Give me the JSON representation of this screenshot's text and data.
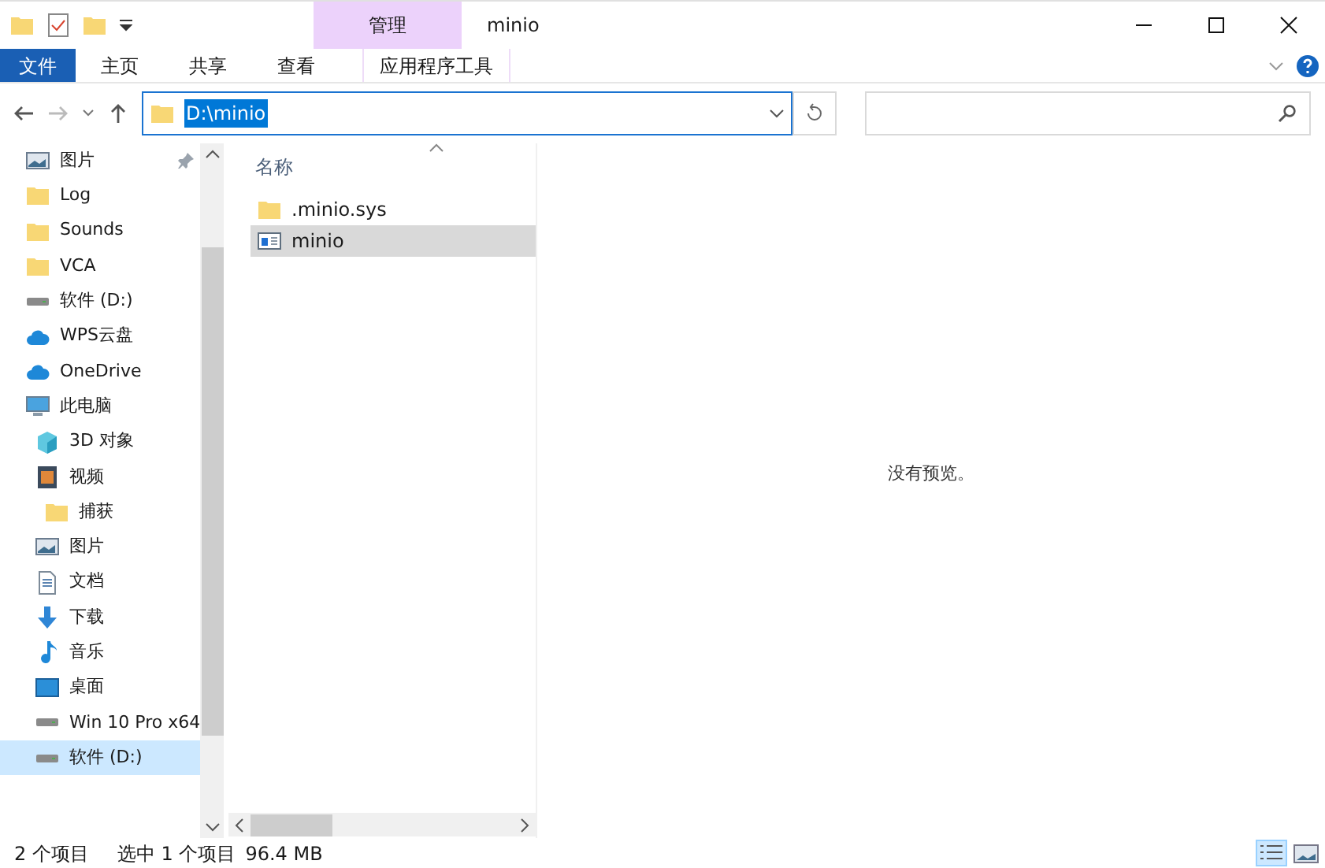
{
  "window": {
    "title": "minio",
    "context_tab": "管理"
  },
  "ribbon": {
    "tabs": [
      {
        "label": "文件",
        "kind": "file",
        "selected": false
      },
      {
        "label": "主页",
        "kind": "tab",
        "selected": false
      },
      {
        "label": "共享",
        "kind": "tab",
        "selected": false
      },
      {
        "label": "查看",
        "kind": "tab",
        "selected": false
      },
      {
        "label": "应用程序工具",
        "kind": "context",
        "selected": false
      }
    ]
  },
  "address": {
    "path": "D:\\minio",
    "selected": true
  },
  "sidebar": {
    "items": [
      {
        "label": "图片",
        "kind": "picture",
        "pinned": true,
        "selected": false
      },
      {
        "label": "Log",
        "kind": "folder",
        "selected": false
      },
      {
        "label": "Sounds",
        "kind": "folder",
        "selected": false
      },
      {
        "label": "VCA",
        "kind": "folder",
        "selected": false
      },
      {
        "label": "软件 (D:)",
        "kind": "drive",
        "selected": false
      },
      {
        "label": "WPS云盘",
        "kind": "cloud",
        "selected": false
      },
      {
        "label": "OneDrive",
        "kind": "cloud",
        "selected": false
      },
      {
        "label": "此电脑",
        "kind": "pc",
        "selected": false,
        "children": [
          {
            "label": "3D 对象",
            "kind": "cube",
            "selected": false
          },
          {
            "label": "视频",
            "kind": "video",
            "selected": false,
            "children": [
              {
                "label": "捕获",
                "kind": "folder",
                "selected": false
              }
            ]
          },
          {
            "label": "图片",
            "kind": "picture",
            "selected": false
          },
          {
            "label": "文档",
            "kind": "document",
            "selected": false
          },
          {
            "label": "下载",
            "kind": "download",
            "selected": false
          },
          {
            "label": "音乐",
            "kind": "music",
            "selected": false
          },
          {
            "label": "桌面",
            "kind": "desktop",
            "selected": false
          },
          {
            "label": "Win 10 Pro x64",
            "kind": "drive",
            "selected": false
          },
          {
            "label": "软件 (D:)",
            "kind": "drive",
            "selected": true
          }
        ]
      }
    ]
  },
  "files": {
    "column": "名称",
    "rows": [
      {
        "name": ".minio.sys",
        "kind": "folder",
        "selected": false
      },
      {
        "name": "minio",
        "kind": "app",
        "selected": true
      }
    ]
  },
  "preview": {
    "message": "没有预览。"
  },
  "status_bar": {
    "count": "2 个项目",
    "selection": "选中 1 个项目",
    "size": "96.4 MB"
  }
}
